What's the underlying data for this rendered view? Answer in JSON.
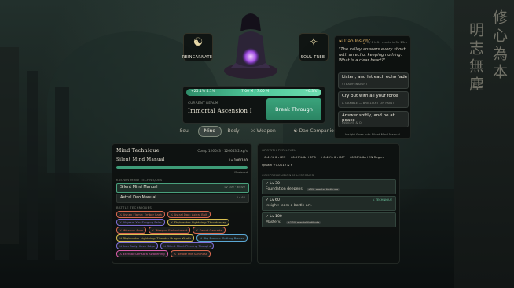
{
  "topbar": {
    "reincarnate": {
      "icon": "yin-yang-icon",
      "label": "REINCARNATE"
    },
    "soul_tree": {
      "icon": "tree-icon",
      "label": "SOUL TREE"
    }
  },
  "cultivation": {
    "progress_percent": "+25.1% 4.1%",
    "progress_value": "7.00 M / 7.00 M",
    "progress_rate": "+0.3/s",
    "progress_fraction": 1.0,
    "realm_label": "CURRENT REALM",
    "realm_value": "Immortal Ascension I",
    "break_label": "Break Through"
  },
  "tabs": [
    {
      "label": "Soul"
    },
    {
      "label": "Mind",
      "active": true
    },
    {
      "label": "Body"
    },
    {
      "label": "⚔ Weapon"
    },
    {
      "label": "☯ Dao Companion"
    }
  ],
  "dao_insight": {
    "title": "☯ Dao Insight",
    "meta": "9 / 8 left · resets in 5h 23m",
    "quote": "\"The valley answers every shout with an echo, keeping nothing. What is a clear heart?\"",
    "choices": [
      {
        "text": "Listen, and let each echo fade",
        "sub": "STEADY INSIGHT"
      },
      {
        "text": "Cry out with all your force",
        "sub": "A GAMBLE — BRILLIANT OR FAINT"
      },
      {
        "text": "Answer softly, and be at peace",
        "sub": "INSIGHT & QI"
      }
    ],
    "footer": "Insight flows into Silent Mind Manual"
  },
  "mind_technique": {
    "heading": "Mind Technique",
    "comp": "Comp 126643 · 126643.2 xp/s",
    "current_name": "Silent Mind Manual",
    "current_level": "Lv 100/100",
    "progress_fraction": 1.0,
    "mastered": "Mastered",
    "known_label": "KNOWN MIND TECHNIQUES",
    "known": [
      {
        "name": "Silent Mind Manual",
        "right": "Lv 100 · active",
        "selected": true
      },
      {
        "name": "Astral Dao Manual",
        "right": "Lv 60",
        "selected": false
      }
    ],
    "battle_label": "BATTLE TECHNIQUES",
    "battle": [
      {
        "name": "⚔ Ashen Flame: Ember Lash",
        "color": "#d9684f"
      },
      {
        "name": "⚔ Astral Dao: Astral Bolt",
        "color": "#d9684f"
      },
      {
        "name": "⚔ Abyssal Yin: Surging Palm",
        "color": "#7f6fd8"
      },
      {
        "name": "⚔ Skybreaker Lightning: Thunderclap",
        "color": "#d9c050"
      },
      {
        "name": "⚔ Weapon Aura",
        "color": "#d9684f"
      },
      {
        "name": "⚔ Weapon Embodiment",
        "color": "#d9684f"
      },
      {
        "name": "⚔ Sword Cascade",
        "color": "#d9684f"
      },
      {
        "name": "⚔ Skybreaker Lightning: Thunder Dragon Wrath",
        "color": "#d9c050"
      },
      {
        "name": "⚔ Sky Dancer: Cutting Breeze",
        "color": "#5aa7d4"
      },
      {
        "name": "⚔ Iron Body: Keen Edge",
        "color": "#7f6fd8"
      },
      {
        "name": "⚔ Silent Mind: Piercing Thought",
        "color": "#7f6fd8"
      },
      {
        "name": "⚔ Eternal Samsara Awakening",
        "color": "#d85ca8"
      },
      {
        "name": "⚔ Before the Sun Rose",
        "color": "#d9684f"
      }
    ]
  },
  "growth": {
    "label": "GROWTH PER LEVEL",
    "stats": [
      "+0.41% & rl EN",
      "+0.27% & rl SPD",
      "+0.45% & rl MP",
      "+0.38% & rl EN Regen",
      "QiGain +1.0112 & rl"
    ],
    "milestones_label": "COMPREHENSION MILESTONES",
    "milestones": [
      {
        "level": "✓ Lv 30",
        "desc": "Foundation deepens.",
        "bonus": "+5% mental fortitude",
        "tag": ""
      },
      {
        "level": "✓ Lv 60",
        "desc": "Insight: learn a battle art.",
        "bonus": "",
        "tag": "⚔ TECHNIQUE"
      },
      {
        "level": "✓ Lv 100",
        "desc": "Mastery.",
        "bonus": "+10% mental fortitude",
        "tag": ""
      }
    ]
  },
  "decor": {
    "banner_right": [
      "修心為本",
      "明志無塵"
    ]
  }
}
